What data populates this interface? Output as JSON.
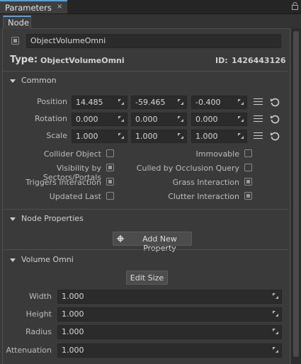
{
  "panel_tab": {
    "label": "Parameters",
    "close": "×"
  },
  "node_tab": {
    "label": "Node"
  },
  "object": {
    "name": "ObjectVolumeOmni",
    "type_label": "Type:",
    "type_value": "ObjectVolumeOmni",
    "id_label": "ID:",
    "id_value": "1426443126",
    "enabled": true
  },
  "sections": {
    "common": "Common",
    "node_properties": "Node Properties",
    "volume_omni": "Volume Omni"
  },
  "transform": [
    {
      "label": "Position",
      "values": [
        "14.485",
        "-59.465",
        "-0.400"
      ]
    },
    {
      "label": "Rotation",
      "values": [
        "0.000",
        "0.000",
        "0.000"
      ]
    },
    {
      "label": "Scale",
      "values": [
        "1.000",
        "1.000",
        "1.000"
      ]
    }
  ],
  "flags_left": [
    {
      "label": "Collider Object",
      "checked": false
    },
    {
      "label": "Visibility by Sectors/Portals",
      "checked": true
    },
    {
      "label": "Triggers Interaction",
      "checked": true
    },
    {
      "label": "Updated Last",
      "checked": false
    }
  ],
  "flags_right": [
    {
      "label": "Immovable",
      "checked": false
    },
    {
      "label": "Culled by Occlusion Query",
      "checked": false
    },
    {
      "label": "Grass Interaction",
      "checked": true
    },
    {
      "label": "Clutter Interaction",
      "checked": true
    }
  ],
  "add_property_button": "Add New Property",
  "edit_size_button": "Edit Size",
  "volume_fields": [
    {
      "label": "Width",
      "value": "1.000"
    },
    {
      "label": "Height",
      "value": "1.000"
    },
    {
      "label": "Radius",
      "value": "1.000"
    },
    {
      "label": "Attenuation",
      "value": "1.000"
    }
  ],
  "colors": {
    "accent": "#5aa0d8",
    "background": "#3a3a3a",
    "field": "#2b2b2b"
  }
}
